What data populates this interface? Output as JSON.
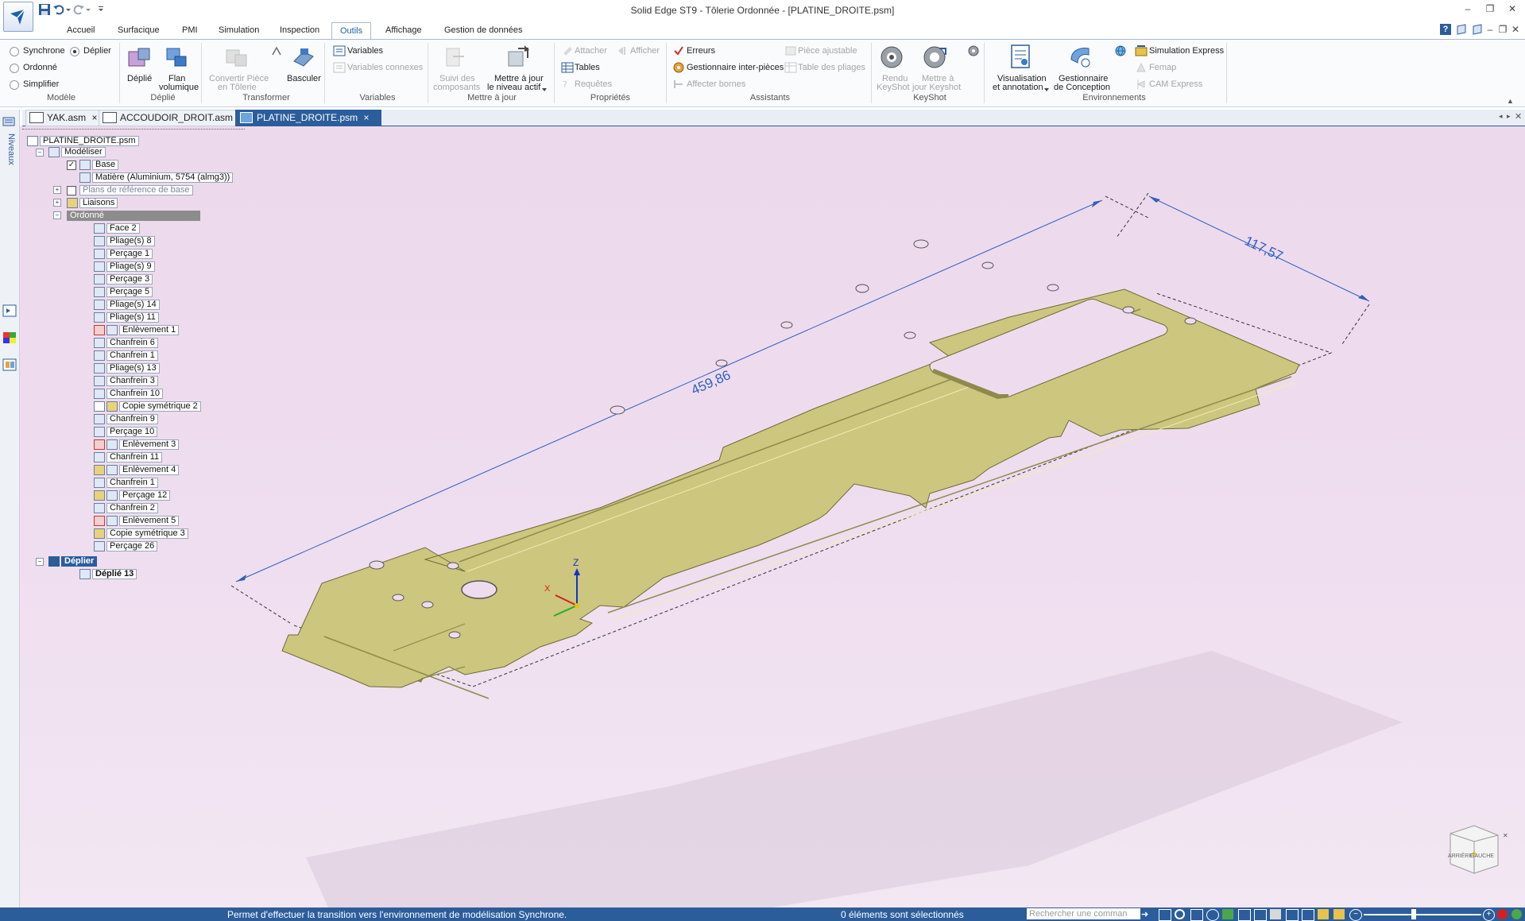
{
  "window": {
    "title": "Solid Edge ST9 - Tôlerie Ordonnée - [PLATINE_DROITE.psm]"
  },
  "menu": {
    "tabs": [
      "Accueil",
      "Surfacique",
      "PMI",
      "Simulation",
      "Inspection",
      "Outils",
      "Affichage",
      "Gestion de données"
    ],
    "active": "Outils"
  },
  "ribbon": {
    "modele": {
      "label": "Modèle",
      "synchrone": "Synchrone",
      "deplier": "Déplier",
      "ordonne": "Ordonné",
      "simplifier": "Simplifier"
    },
    "deplie_grp": {
      "label": "Déplié",
      "deplie": "Déplié",
      "flan_1": "Flan",
      "flan_2": "volumique"
    },
    "transformer": {
      "label": "Transformer",
      "convertir_1": "Convertir Pièce",
      "convertir_2": "en Tôlerie",
      "basculer": "Basculer"
    },
    "variables": {
      "label": "Variables",
      "variables": "Variables",
      "connexes": "Variables connexes"
    },
    "mettre_a_jour": {
      "label": "Mettre à jour",
      "suivi_1": "Suivi des",
      "suivi_2": "composants",
      "niveau_1": "Mettre à jour",
      "niveau_2": "le niveau actif"
    },
    "proprietes": {
      "label": "Propriétés",
      "attacher": "Attacher",
      "afficher": "Afficher",
      "tables": "Tables",
      "requetes": "Requêtes"
    },
    "assistants": {
      "label": "Assistants",
      "erreurs": "Erreurs",
      "gestionnaire": "Gestionnaire inter-pièces",
      "bornes": "Affecter bornes",
      "piece_ajustable": "Pièce ajustable",
      "table_pliages": "Table des pliages"
    },
    "keyshot": {
      "label": "KeyShot",
      "rendu_1": "Rendu",
      "rendu_2": "KeyShot",
      "maj_1": "Mettre à",
      "maj_2": "jour Keyshot"
    },
    "environnements": {
      "label": "Environnements",
      "visu_1": "Visualisation",
      "visu_2": "et annotation",
      "gest_1": "Gestionnaire",
      "gest_2": "de Conception",
      "simulation": "Simulation Express",
      "femap": "Femap",
      "cam": "CAM Express"
    }
  },
  "doc_tabs": [
    {
      "label": "YAK.asm",
      "close": "×"
    },
    {
      "label": "ACCOUDOIR_DROIT.asm",
      "close": "×"
    },
    {
      "label": "PLATINE_DROITE.psm",
      "close": "×"
    }
  ],
  "left_strip": {
    "niveaux": "Niveaux"
  },
  "tree": {
    "root": "PLATINE_DROITE.psm",
    "modeliser": "Modéliser",
    "base": "Base",
    "matiere": "Matière (Aluminium, 5754 (almg3))",
    "plans": "Plans de référence de base",
    "liaisons": "Liaisons",
    "ordonne": "Ordonné",
    "features": [
      "Face 2",
      "Pliage(s) 8",
      "Perçage 1",
      "Pliage(s) 9",
      "Perçage 3",
      "Perçage 5",
      "Pliage(s) 14",
      "Pliage(s) 11",
      "Enlèvement 1",
      "Chanfrein 6",
      "Chanfrein 1",
      "Pliage(s) 13",
      "Chanfrein 3",
      "Chanfrein 10",
      "Copie symétrique 2",
      "Chanfrein 9",
      "Perçage 10",
      "Enlèvement 3",
      "Chanfrein 11",
      "Enlèvement 4",
      "Chanfrein 1",
      "Perçage 12",
      "Chanfrein 2",
      "Enlèvement 5",
      "Copie symétrique 3",
      "Perçage 26"
    ],
    "deplier": "Déplier",
    "deplie13": "Déplié 13"
  },
  "viewport": {
    "dim_length": "459,86",
    "dim_width": "117,57",
    "axis_z": "Z",
    "axis_x": "X",
    "viewcube_1": "ARRIÈRE",
    "viewcube_2": "GAUCHE",
    "part_color": "#c9c27a",
    "part_edge": "#6e6a3a",
    "bg_color": "#eedcee"
  },
  "status": {
    "message": "Permet d'effectuer la transition vers l'environnement de modélisation Synchrone.",
    "selection": "0 éléments sont sélectionnés",
    "search_placeholder": "Rechercher une comman"
  },
  "colors": {
    "accent": "#2c5d9b",
    "active_tab": "#1b5fa7"
  }
}
